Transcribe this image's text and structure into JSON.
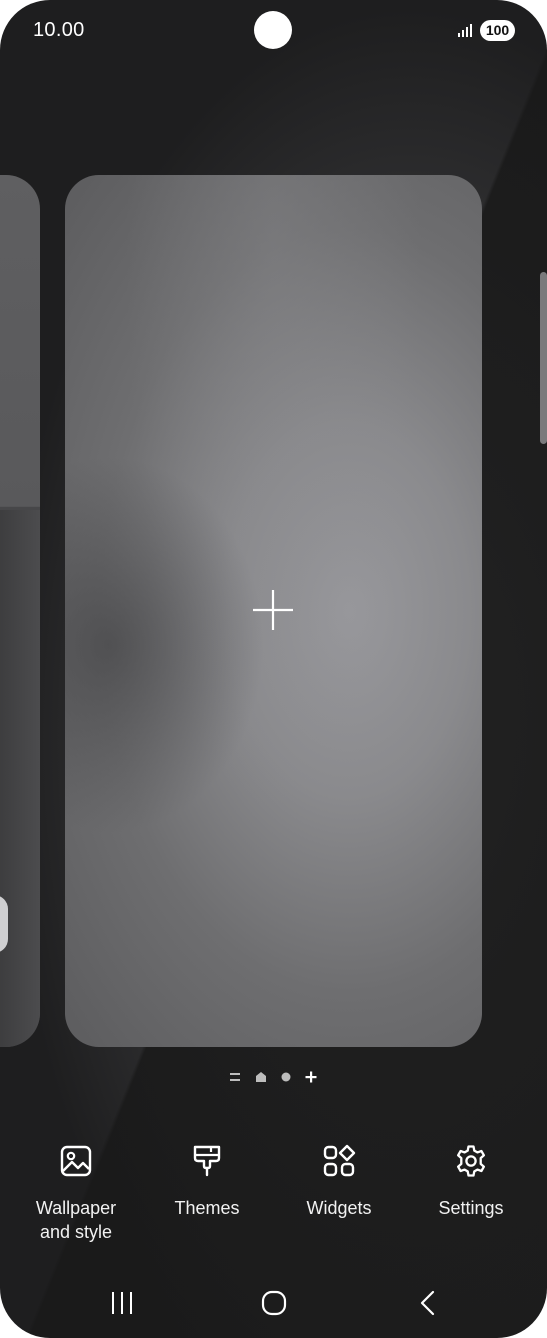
{
  "status_bar": {
    "time": "10.00",
    "battery": "100",
    "signal_icon": "signal-bars-icon"
  },
  "pages": {
    "add_page_icon": "plus-icon",
    "indicator": [
      {
        "icon": "menu-lines-icon",
        "active": false
      },
      {
        "icon": "home-icon",
        "active": false
      },
      {
        "icon": "dot-icon",
        "active": false
      },
      {
        "icon": "plus-icon",
        "active": true
      }
    ]
  },
  "bottom_menu": {
    "items": [
      {
        "label": "Wallpaper and style",
        "line1": "Wallpaper",
        "line2": "and style",
        "icon": "image-icon"
      },
      {
        "label": "Themes",
        "icon": "paint-brush-icon"
      },
      {
        "label": "Widgets",
        "icon": "widgets-grid-icon"
      },
      {
        "label": "Settings",
        "icon": "gear-icon"
      }
    ]
  },
  "nav_bar": {
    "recents_icon": "recents-icon",
    "home_icon": "home-button-icon",
    "back_icon": "back-icon"
  },
  "colors": {
    "background": "#1c1c1d",
    "card": "#8a8a8d",
    "text": "#ffffff"
  }
}
